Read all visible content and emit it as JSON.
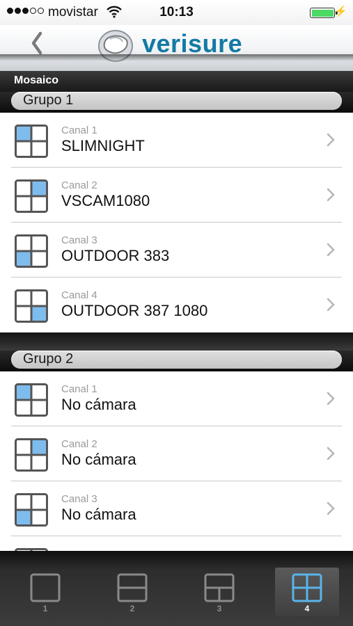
{
  "status": {
    "carrier": "movistar",
    "time": "10:13"
  },
  "header": {
    "logo_text": "verisure"
  },
  "section_title": "Mosaico",
  "groups": [
    {
      "title": "Grupo 1",
      "items": [
        {
          "channel": "Canal 1",
          "name": "SLIMNIGHT"
        },
        {
          "channel": "Canal 2",
          "name": "VSCAM1080"
        },
        {
          "channel": "Canal 3",
          "name": "OUTDOOR 383"
        },
        {
          "channel": "Canal 4",
          "name": "OUTDOOR 387 1080"
        }
      ]
    },
    {
      "title": "Grupo 2",
      "items": [
        {
          "channel": "Canal 1",
          "name": "No cámara"
        },
        {
          "channel": "Canal 2",
          "name": "No cámara"
        },
        {
          "channel": "Canal 3",
          "name": "No cámara"
        }
      ]
    }
  ],
  "tabs": [
    {
      "label": "1",
      "icon": "single-view-icon"
    },
    {
      "label": "2",
      "icon": "split-two-view-icon"
    },
    {
      "label": "3",
      "icon": "split-three-view-icon"
    },
    {
      "label": "4",
      "icon": "grid-four-view-icon",
      "active": true
    }
  ],
  "colors": {
    "accent": "#7fbcee",
    "brand": "#137aa4",
    "battery": "#4cd964"
  }
}
